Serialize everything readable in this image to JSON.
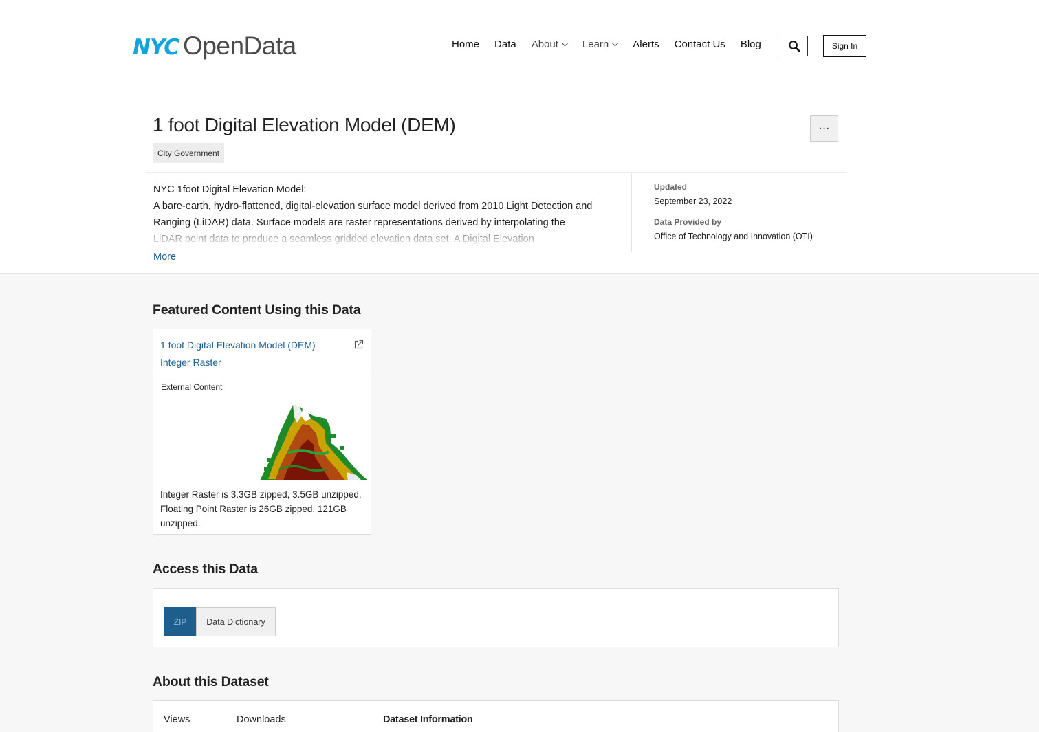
{
  "header": {
    "logo_nyc": "NYC",
    "logo_open": "OpenData",
    "nav": [
      {
        "label": "Home"
      },
      {
        "label": "Data"
      },
      {
        "label": "About"
      },
      {
        "label": "Learn"
      },
      {
        "label": "Alerts"
      },
      {
        "label": "Contact Us"
      },
      {
        "label": "Blog"
      }
    ],
    "sign_in": "Sign In"
  },
  "dataset": {
    "title": "1 foot Digital Elevation Model (DEM)",
    "category": "City Government",
    "more_menu": "···",
    "description": [
      "NYC 1foot Digital Elevation Model:",
      "A bare-earth, hydro-flattened, digital-elevation surface model derived from 2010 Light Detection and Ranging (LiDAR) data. Surface models are raster representations derived by interpolating the LiDAR point data to produce a seamless gridded elevation data set. A Digital Elevation"
    ],
    "more_link": "More",
    "updated_label": "Updated",
    "updated_value": "September 23, 2022",
    "provided_label": "Data Provided by",
    "provided_value": "Office of Technology and Innovation (OTI)"
  },
  "featured": {
    "heading": "Featured Content Using this Data",
    "card_title": "1 foot Digital Elevation Model (DEM) Integer Raster",
    "card_kind": "External Content",
    "card_desc": "Integer Raster is 3.3GB zipped, 3.5GB unzipped. Floating Point Raster is 26GB zipped, 121GB unzipped."
  },
  "access": {
    "heading": "Access this Data",
    "zip": "ZIP",
    "dictionary": "Data Dictionary"
  },
  "about": {
    "heading": "About this Dataset",
    "views_label": "Views",
    "downloads_label": "Downloads",
    "info_label": "Dataset Information"
  },
  "colors": {
    "brand_blue": "#13a4dd",
    "link": "#1e5e8c"
  }
}
